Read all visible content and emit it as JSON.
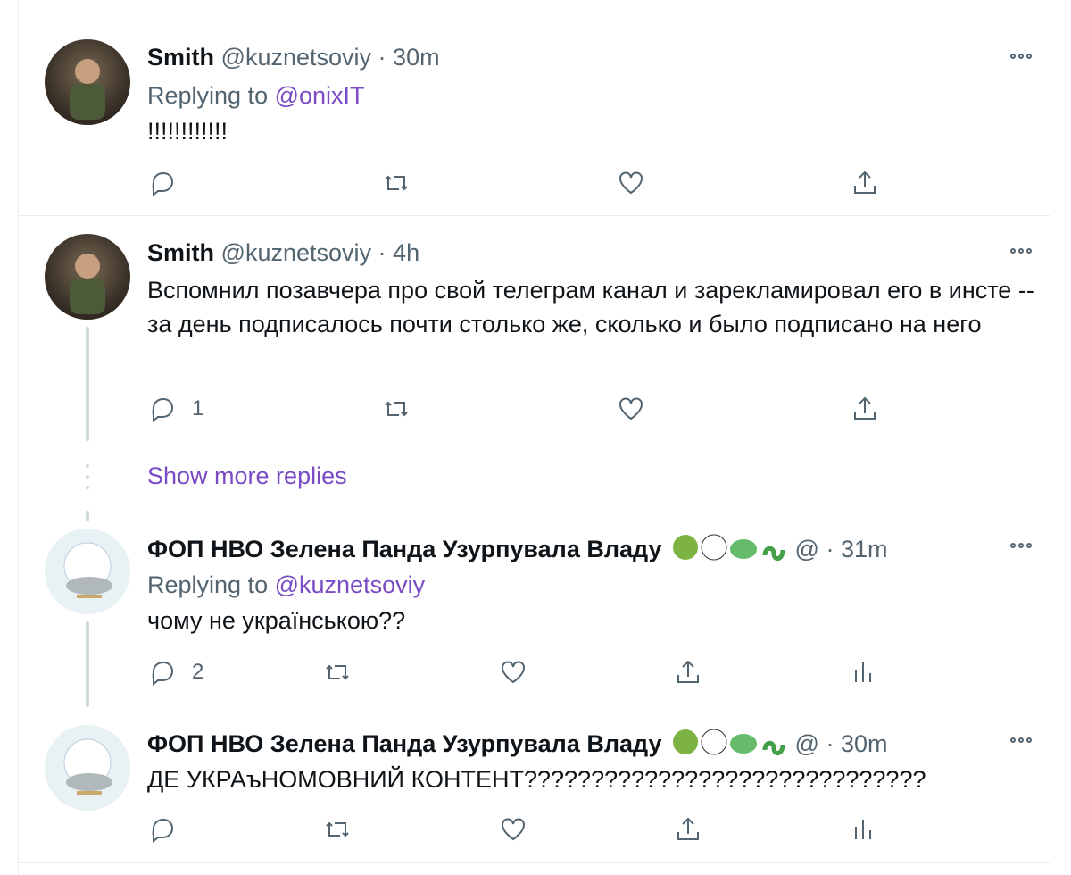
{
  "tweets": [
    {
      "name": "Smith",
      "handle": "@kuznetsoviy",
      "sep": "·",
      "time": "30m",
      "reply_prefix": "Replying to",
      "reply_to": "@onixIT",
      "text": "!!!!!!!!!!!!",
      "reply_count": "",
      "avatar": "man-photo"
    },
    {
      "name": "Smith",
      "handle": "@kuznetsoviy",
      "sep": "·",
      "time": "4h",
      "text": "Вспомнил позавчера про свой телеграм канал и зарекламировал его в инсте -- за день подписалось почти столько же, сколько и было подписано на него",
      "reply_count": "1",
      "avatar": "man-photo"
    },
    {
      "name": "ФОП НВО Зелена Панда Узурпувала Владу",
      "handle": "@",
      "sep": "·",
      "time": "31m",
      "reply_prefix": "Replying to",
      "reply_to": "@kuznetsoviy",
      "text": "чому не українською??",
      "reply_count": "2",
      "avatar": "cat-illustration"
    },
    {
      "name": "ФОП НВО Зелена Панда Узурпувала Владу",
      "handle": "@",
      "sep": "·",
      "time": "30m",
      "text": "ДЕ УКРАъНОМОВНИЙ КОНТЕНТ??????????????????????????????",
      "reply_count": "",
      "avatar": "cat-illustration"
    }
  ],
  "show_more": "Show more replies",
  "colors": {
    "accent": "#794bc4",
    "secondary_text": "#536471",
    "border": "#e6ecf0"
  },
  "icons": [
    "reply-icon",
    "retweet-icon",
    "like-icon",
    "share-icon",
    "analytics-icon",
    "more-icon"
  ]
}
